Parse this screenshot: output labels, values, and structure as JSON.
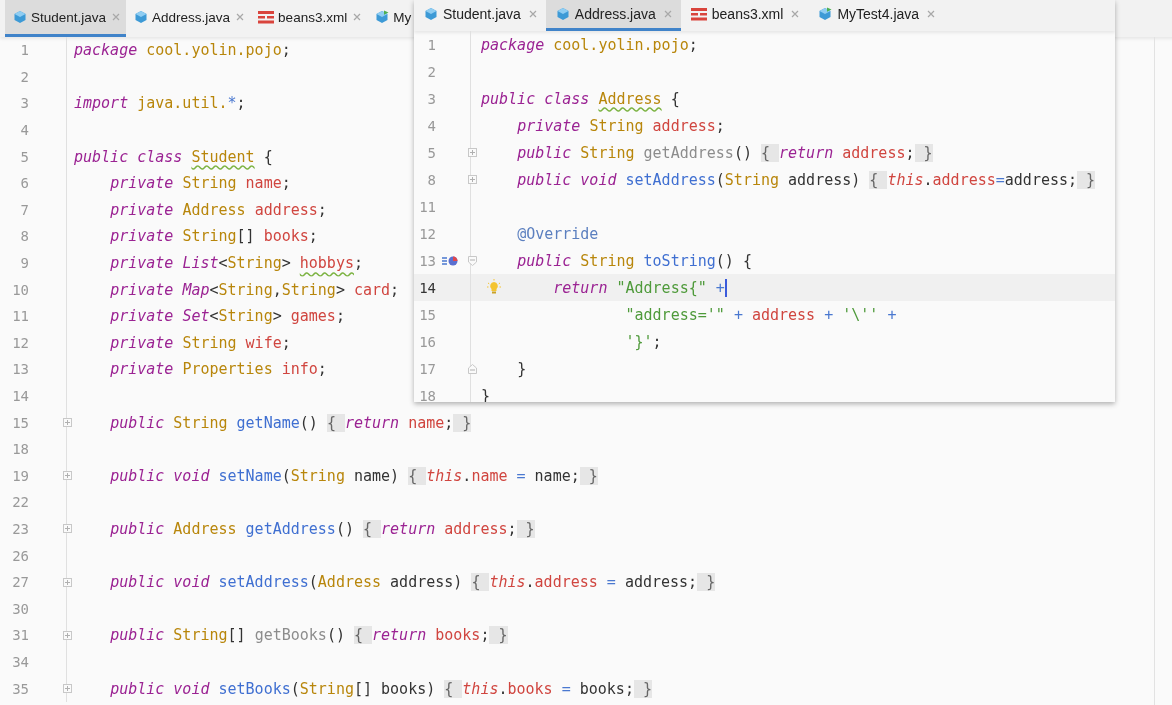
{
  "editors": [
    {
      "kind": "main",
      "tabs": [
        {
          "label": "Student.java",
          "kind": "java",
          "selected": true
        },
        {
          "label": "Address.java",
          "kind": "java",
          "selected": false
        },
        {
          "label": "beans3.xml",
          "kind": "xml",
          "selected": false
        },
        {
          "label": "My",
          "kind": "test",
          "selected": false
        }
      ],
      "lines": [
        {
          "number": "1",
          "tokens": [
            {
              "kind": "keyword",
              "text": "package "
            },
            {
              "kind": "type",
              "text": "cool.yolin.pojo"
            },
            {
              "kind": "plain",
              "text": ";"
            }
          ]
        },
        {
          "number": "2"
        },
        {
          "number": "3",
          "tokens": [
            {
              "kind": "keyword",
              "text": "import "
            },
            {
              "kind": "type",
              "text": "java.util."
            },
            {
              "kind": "operator",
              "text": "*"
            },
            {
              "kind": "plain",
              "text": ";"
            }
          ]
        },
        {
          "number": "4"
        },
        {
          "number": "5",
          "tokens": [
            {
              "kind": "keyword",
              "text": "public class "
            },
            {
              "kind": "declaration",
              "text": "Student"
            },
            {
              "kind": "plain",
              "text": " {"
            }
          ]
        },
        {
          "number": "6",
          "tokens": [
            {
              "kind": "keyword",
              "text": "    private "
            },
            {
              "kind": "type",
              "text": "String "
            },
            {
              "kind": "field",
              "text": "name"
            },
            {
              "kind": "plain",
              "text": ";"
            }
          ]
        },
        {
          "number": "7",
          "tokens": [
            {
              "kind": "keyword",
              "text": "    private "
            },
            {
              "kind": "type",
              "text": "Address "
            },
            {
              "kind": "field",
              "text": "address"
            },
            {
              "kind": "plain",
              "text": ";"
            }
          ]
        },
        {
          "number": "8",
          "tokens": [
            {
              "kind": "keyword",
              "text": "    private "
            },
            {
              "kind": "type",
              "text": "String"
            },
            {
              "kind": "plain",
              "text": "[] "
            },
            {
              "kind": "field",
              "text": "books"
            },
            {
              "kind": "plain",
              "text": ";"
            }
          ]
        },
        {
          "number": "9",
          "tokens": [
            {
              "kind": "keyword",
              "text": "    private "
            },
            {
              "kind": "iface",
              "text": "List"
            },
            {
              "kind": "plain",
              "text": "<"
            },
            {
              "kind": "type",
              "text": "String"
            },
            {
              "kind": "plain",
              "text": "> "
            },
            {
              "kind": "typo",
              "text": "hobbys"
            },
            {
              "kind": "plain",
              "text": ";"
            }
          ]
        },
        {
          "number": "10",
          "tokens": [
            {
              "kind": "keyword",
              "text": "    private "
            },
            {
              "kind": "iface",
              "text": "Map"
            },
            {
              "kind": "plain",
              "text": "<"
            },
            {
              "kind": "type",
              "text": "String"
            },
            {
              "kind": "plain",
              "text": ","
            },
            {
              "kind": "type",
              "text": "String"
            },
            {
              "kind": "plain",
              "text": "> "
            },
            {
              "kind": "field",
              "text": "card"
            },
            {
              "kind": "plain",
              "text": ";"
            }
          ]
        },
        {
          "number": "11",
          "tokens": [
            {
              "kind": "keyword",
              "text": "    private "
            },
            {
              "kind": "iface",
              "text": "Set"
            },
            {
              "kind": "plain",
              "text": "<"
            },
            {
              "kind": "type",
              "text": "String"
            },
            {
              "kind": "plain",
              "text": "> "
            },
            {
              "kind": "field",
              "text": "games"
            },
            {
              "kind": "plain",
              "text": ";"
            }
          ]
        },
        {
          "number": "12",
          "tokens": [
            {
              "kind": "keyword",
              "text": "    private "
            },
            {
              "kind": "type",
              "text": "String "
            },
            {
              "kind": "field",
              "text": "wife"
            },
            {
              "kind": "plain",
              "text": ";"
            }
          ]
        },
        {
          "number": "13",
          "tokens": [
            {
              "kind": "keyword",
              "text": "    private "
            },
            {
              "kind": "type",
              "text": "Properties "
            },
            {
              "kind": "field",
              "text": "info"
            },
            {
              "kind": "plain",
              "text": ";"
            }
          ]
        },
        {
          "number": "14"
        },
        {
          "number": "15",
          "collapsed": true,
          "tokens": [
            {
              "kind": "keyword",
              "text": "    public "
            },
            {
              "kind": "type",
              "text": "String "
            },
            {
              "kind": "method",
              "text": "getName"
            },
            {
              "kind": "plain",
              "text": "() "
            },
            {
              "kind": "folded",
              "text": "{ "
            },
            {
              "kind": "keyword",
              "text": "return "
            },
            {
              "kind": "field",
              "text": "name"
            },
            {
              "kind": "plain",
              "text": ";"
            },
            {
              "kind": "folded",
              "text": " }"
            }
          ]
        },
        {
          "number": "18"
        },
        {
          "number": "19",
          "collapsed": true,
          "tokens": [
            {
              "kind": "keyword",
              "text": "    public void "
            },
            {
              "kind": "method",
              "text": "setName"
            },
            {
              "kind": "plain",
              "text": "("
            },
            {
              "kind": "type",
              "text": "String "
            },
            {
              "kind": "plain",
              "text": "name) "
            },
            {
              "kind": "folded",
              "text": "{ "
            },
            {
              "kind": "self",
              "text": "this"
            },
            {
              "kind": "plain",
              "text": "."
            },
            {
              "kind": "field",
              "text": "name"
            },
            {
              "kind": "operator",
              "text": " = "
            },
            {
              "kind": "plain",
              "text": "name;"
            },
            {
              "kind": "folded",
              "text": " }"
            }
          ]
        },
        {
          "number": "22"
        },
        {
          "number": "23",
          "collapsed": true,
          "tokens": [
            {
              "kind": "keyword",
              "text": "    public "
            },
            {
              "kind": "type",
              "text": "Address "
            },
            {
              "kind": "method",
              "text": "getAddress"
            },
            {
              "kind": "plain",
              "text": "() "
            },
            {
              "kind": "folded",
              "text": "{ "
            },
            {
              "kind": "keyword",
              "text": "return "
            },
            {
              "kind": "field",
              "text": "address"
            },
            {
              "kind": "plain",
              "text": ";"
            },
            {
              "kind": "folded",
              "text": " }"
            }
          ]
        },
        {
          "number": "26"
        },
        {
          "number": "27",
          "collapsed": true,
          "tokens": [
            {
              "kind": "keyword",
              "text": "    public void "
            },
            {
              "kind": "method",
              "text": "setAddress"
            },
            {
              "kind": "plain",
              "text": "("
            },
            {
              "kind": "type",
              "text": "Address "
            },
            {
              "kind": "plain",
              "text": "address) "
            },
            {
              "kind": "folded",
              "text": "{ "
            },
            {
              "kind": "self",
              "text": "this"
            },
            {
              "kind": "plain",
              "text": "."
            },
            {
              "kind": "field",
              "text": "address"
            },
            {
              "kind": "operator",
              "text": " = "
            },
            {
              "kind": "plain",
              "text": "address;"
            },
            {
              "kind": "folded",
              "text": " }"
            }
          ]
        },
        {
          "number": "30"
        },
        {
          "number": "31",
          "collapsed": true,
          "tokens": [
            {
              "kind": "keyword",
              "text": "    public "
            },
            {
              "kind": "type",
              "text": "String"
            },
            {
              "kind": "plain",
              "text": "[] "
            },
            {
              "kind": "unused",
              "text": "getBooks"
            },
            {
              "kind": "plain",
              "text": "() "
            },
            {
              "kind": "folded",
              "text": "{ "
            },
            {
              "kind": "keyword",
              "text": "return "
            },
            {
              "kind": "field",
              "text": "books"
            },
            {
              "kind": "plain",
              "text": ";"
            },
            {
              "kind": "folded",
              "text": " }"
            }
          ]
        },
        {
          "number": "34"
        },
        {
          "number": "35",
          "collapsed": true,
          "tokens": [
            {
              "kind": "keyword",
              "text": "    public void "
            },
            {
              "kind": "method",
              "text": "setBooks"
            },
            {
              "kind": "plain",
              "text": "("
            },
            {
              "kind": "type",
              "text": "String"
            },
            {
              "kind": "plain",
              "text": "[] books) "
            },
            {
              "kind": "folded",
              "text": "{ "
            },
            {
              "kind": "self",
              "text": "this"
            },
            {
              "kind": "plain",
              "text": "."
            },
            {
              "kind": "field",
              "text": "books"
            },
            {
              "kind": "operator",
              "text": " = "
            },
            {
              "kind": "plain",
              "text": "books;"
            },
            {
              "kind": "folded",
              "text": " }"
            }
          ]
        }
      ]
    },
    {
      "kind": "floating",
      "tabs": [
        {
          "label": "Student.java",
          "kind": "java",
          "selected": false
        },
        {
          "label": "Address.java",
          "kind": "java",
          "selected": true
        },
        {
          "label": "beans3.xml",
          "kind": "xml",
          "selected": false
        },
        {
          "label": "MyTest4.java",
          "kind": "test",
          "selected": false
        }
      ],
      "lines": [
        {
          "number": "1",
          "tokens": [
            {
              "kind": "keyword",
              "text": "package "
            },
            {
              "kind": "type",
              "text": "cool.yolin.pojo"
            },
            {
              "kind": "plain",
              "text": ";"
            }
          ]
        },
        {
          "number": "2"
        },
        {
          "number": "3",
          "tokens": [
            {
              "kind": "keyword",
              "text": "public class "
            },
            {
              "kind": "declaration",
              "text": "Address"
            },
            {
              "kind": "plain",
              "text": " {"
            }
          ]
        },
        {
          "number": "4",
          "tokens": [
            {
              "kind": "keyword",
              "text": "    private "
            },
            {
              "kind": "type",
              "text": "String "
            },
            {
              "kind": "field",
              "text": "address"
            },
            {
              "kind": "plain",
              "text": ";"
            }
          ]
        },
        {
          "number": "5",
          "collapsed": true,
          "tokens": [
            {
              "kind": "keyword",
              "text": "    public "
            },
            {
              "kind": "type",
              "text": "String "
            },
            {
              "kind": "unused",
              "text": "getAddress"
            },
            {
              "kind": "plain",
              "text": "() "
            },
            {
              "kind": "folded",
              "text": "{ "
            },
            {
              "kind": "keyword",
              "text": "return "
            },
            {
              "kind": "field",
              "text": "address"
            },
            {
              "kind": "plain",
              "text": ";"
            },
            {
              "kind": "folded",
              "text": " }"
            }
          ]
        },
        {
          "number": "8",
          "collapsed": true,
          "tokens": [
            {
              "kind": "keyword",
              "text": "    public void "
            },
            {
              "kind": "method",
              "text": "setAddress"
            },
            {
              "kind": "plain",
              "text": "("
            },
            {
              "kind": "type",
              "text": "String "
            },
            {
              "kind": "plain",
              "text": "address) "
            },
            {
              "kind": "folded",
              "text": "{ "
            },
            {
              "kind": "self",
              "text": "this"
            },
            {
              "kind": "plain",
              "text": "."
            },
            {
              "kind": "field",
              "text": "address"
            },
            {
              "kind": "operator",
              "text": "="
            },
            {
              "kind": "plain",
              "text": "address;"
            },
            {
              "kind": "folded",
              "text": " }"
            }
          ]
        },
        {
          "number": "11"
        },
        {
          "number": "12",
          "tokens": [
            {
              "kind": "annotation",
              "text": "    @Override"
            }
          ]
        },
        {
          "number": "13",
          "fold_start": true,
          "overrides": true,
          "tokens": [
            {
              "kind": "keyword",
              "text": "    public "
            },
            {
              "kind": "type",
              "text": "String "
            },
            {
              "kind": "method",
              "text": "toString"
            },
            {
              "kind": "plain",
              "text": "() {"
            }
          ]
        },
        {
          "number": "14",
          "current": true,
          "caret": true,
          "intention": true,
          "tokens": [
            {
              "kind": "keyword",
              "text": "        return "
            },
            {
              "kind": "string",
              "text": "\"Address{\" "
            },
            {
              "kind": "operator",
              "text": "+"
            }
          ]
        },
        {
          "number": "15",
          "tokens": [
            {
              "kind": "string",
              "text": "                \"address='\" "
            },
            {
              "kind": "operator",
              "text": "+ "
            },
            {
              "kind": "field",
              "text": "address "
            },
            {
              "kind": "operator",
              "text": "+ "
            },
            {
              "kind": "string",
              "text": "'\\'' "
            },
            {
              "kind": "operator",
              "text": "+"
            }
          ]
        },
        {
          "number": "16",
          "tokens": [
            {
              "kind": "string",
              "text": "                '}'"
            },
            {
              "kind": "plain",
              "text": ";"
            }
          ]
        },
        {
          "number": "17",
          "fold_end": true,
          "tokens": [
            {
              "kind": "plain",
              "text": "    }"
            }
          ]
        },
        {
          "number": "18",
          "tokens": [
            {
              "kind": "plain",
              "text": "}"
            }
          ]
        }
      ]
    }
  ]
}
